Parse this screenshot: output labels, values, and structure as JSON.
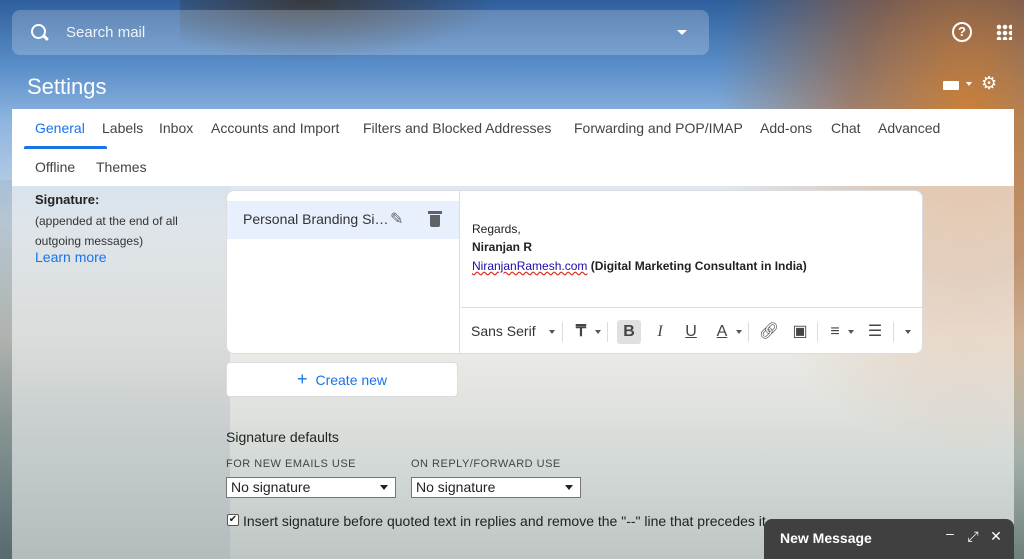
{
  "search": {
    "placeholder": "Search mail"
  },
  "header": {
    "title": "Settings"
  },
  "tabs": [
    {
      "label": "General"
    },
    {
      "label": "Labels"
    },
    {
      "label": "Inbox"
    },
    {
      "label": "Accounts and Import"
    },
    {
      "label": "Filters and Blocked Addresses"
    },
    {
      "label": "Forwarding and POP/IMAP"
    },
    {
      "label": "Add-ons"
    },
    {
      "label": "Chat"
    },
    {
      "label": "Advanced"
    },
    {
      "label": "Offline"
    },
    {
      "label": "Themes"
    }
  ],
  "signature": {
    "label": "Signature:",
    "note": "(appended at the end of all outgoing messages)",
    "learn_more": "Learn more",
    "item_name": "Personal Branding Signature",
    "body_line1": "Regards,",
    "body_line2": "Niranjan R",
    "body_link": "NiranjanRamesh.com",
    "body_rest": " (Digital Marketing Consultant in India)",
    "create_new": "Create new"
  },
  "toolbar": {
    "font": "Sans Serif",
    "bold": "B",
    "italic": "I",
    "underline": "U",
    "text_color": "A"
  },
  "defaults": {
    "title": "Signature defaults",
    "new_emails_label": "FOR NEW EMAILS USE",
    "new_emails_value": "No signature",
    "reply_label": "ON REPLY/FORWARD USE",
    "reply_value": "No signature",
    "insert_before_label": "Insert signature before quoted text in replies and remove the \"--\" line that precedes it."
  },
  "new_message": {
    "title": "New Message"
  },
  "colors": {
    "accent": "#1a73e8",
    "new_message_bg": "#404040"
  }
}
